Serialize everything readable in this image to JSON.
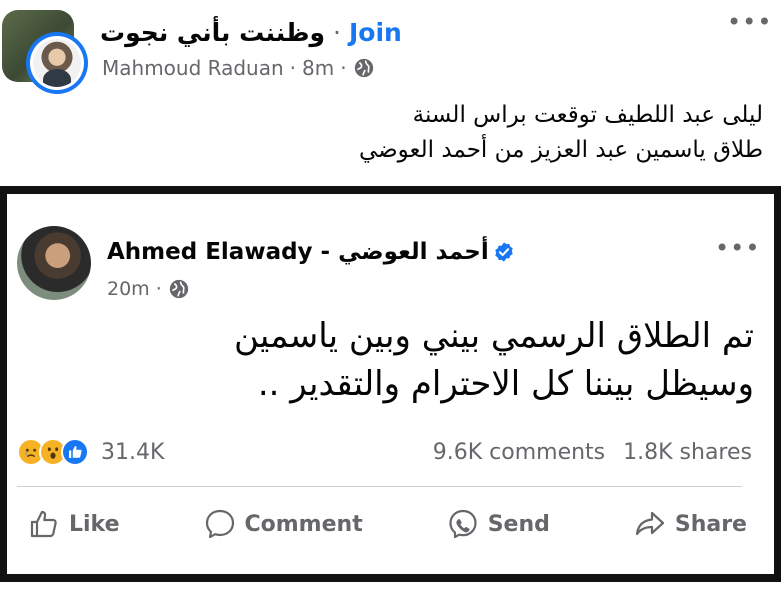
{
  "outer_post": {
    "group_name": "وظننت بأني نجوت",
    "separator": "·",
    "join_label": "Join",
    "author": "Mahmoud Raduan",
    "time": "8m",
    "meta_separator": "·",
    "audience_icon": "globe-icon",
    "more_icon": "more-dots-icon",
    "more_label": "•••",
    "text_lines": [
      "ليلى عبد اللطيف توقعت براس السنة",
      "طلاق ياسمين عبد العزيز من أحمد العوضي"
    ]
  },
  "shared_post": {
    "author_name_en": "Ahmed Elawady -",
    "author_name_ar": "أحمد العوضي",
    "verified_icon": "verified-badge-icon",
    "time": "20m",
    "meta_separator": "·",
    "audience_icon": "globe-icon",
    "more_label": "•••",
    "text_lines": [
      "تم الطلاق الرسمي بيني وبين ياسمين",
      "وسيظل بيننا كل الاحترام والتقدير .."
    ],
    "reactions": {
      "icons": [
        "sad-reaction-icon",
        "wow-reaction-icon",
        "like-reaction-icon"
      ],
      "count": "31.4K",
      "comments": "9.6K comments",
      "shares": "1.8K shares"
    },
    "actions": [
      {
        "label": "Like",
        "icon": "thumbs-up-icon"
      },
      {
        "label": "Comment",
        "icon": "comment-bubble-icon"
      },
      {
        "label": "Send",
        "icon": "messenger-send-icon"
      },
      {
        "label": "Share",
        "icon": "share-arrow-icon"
      }
    ]
  },
  "colors": {
    "brand_blue": "#1877f2",
    "secondary_text": "#65676b",
    "reaction_yellow": "#f7b125",
    "screenshot_border": "#111111"
  }
}
